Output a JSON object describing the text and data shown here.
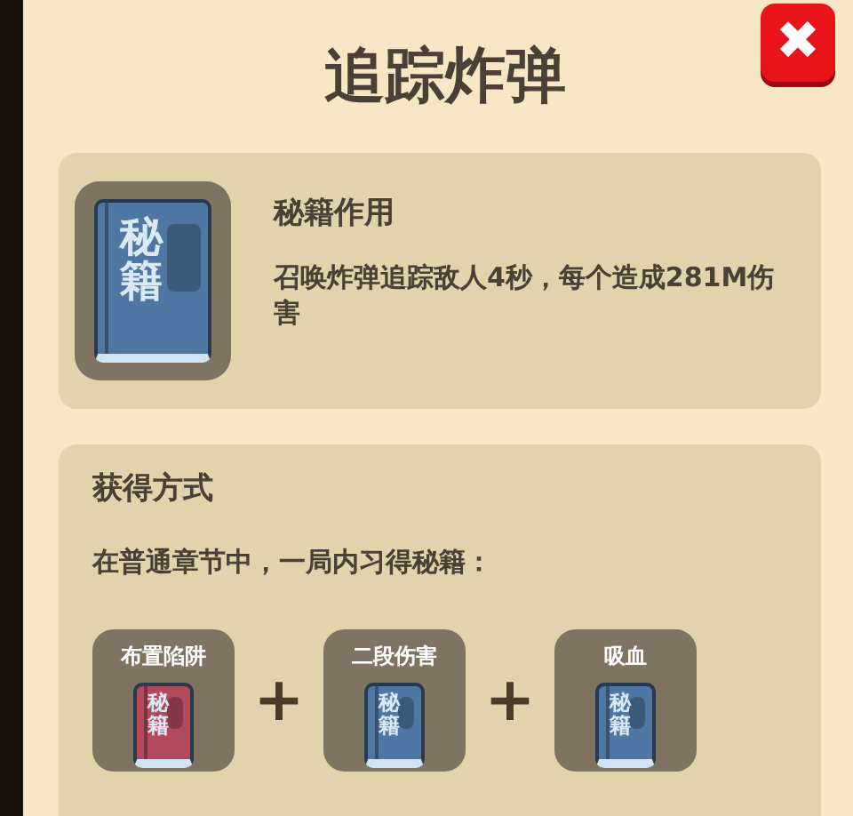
{
  "title": "追踪炸弹",
  "close_button": {
    "label": "✖"
  },
  "effect_card": {
    "book": {
      "cover_text": "秘籍",
      "color": "#4f77a3"
    },
    "heading": "秘籍作用",
    "description": "召唤炸弹追踪敌人4秒，每个造成281M伤害"
  },
  "obtain_card": {
    "heading": "获得方式",
    "instruction": "在普通章节中，一局内习得秘籍：",
    "separator": "+",
    "items": [
      {
        "label": "布置陷阱",
        "cover_text": "秘籍",
        "color": "#b24a5c"
      },
      {
        "label": "二段伤害",
        "cover_text": "秘籍",
        "color": "#4f77a3"
      },
      {
        "label": "吸血",
        "cover_text": "秘籍",
        "color": "#4f77a3"
      }
    ]
  }
}
